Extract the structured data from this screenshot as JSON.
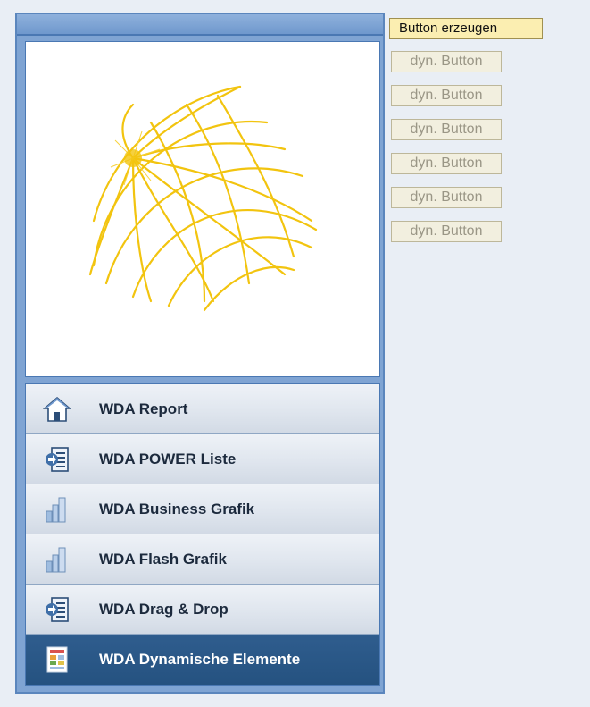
{
  "toolbar": {
    "create_button_label": "Button erzeugen"
  },
  "dynamic_buttons": [
    "dyn. Button",
    "dyn. Button",
    "dyn. Button",
    "dyn. Button",
    "dyn. Button",
    "dyn. Button"
  ],
  "nav": {
    "items": [
      {
        "label": "WDA Report",
        "icon": "home-icon",
        "active": false
      },
      {
        "label": "WDA POWER Liste",
        "icon": "list-transfer-icon",
        "active": false
      },
      {
        "label": "WDA Business Grafik",
        "icon": "bar-chart-icon",
        "active": false
      },
      {
        "label": "WDA Flash Grafik",
        "icon": "bar-chart-icon",
        "active": false
      },
      {
        "label": "WDA Drag & Drop",
        "icon": "list-transfer-icon",
        "active": false
      },
      {
        "label": "WDA Dynamische Elemente",
        "icon": "form-elements-icon",
        "active": true
      }
    ]
  },
  "colors": {
    "panel": "#7fa4d3",
    "active_item": "#2f5d8e",
    "globe": "#f2c40f",
    "create_button": "#fbeeb1"
  }
}
